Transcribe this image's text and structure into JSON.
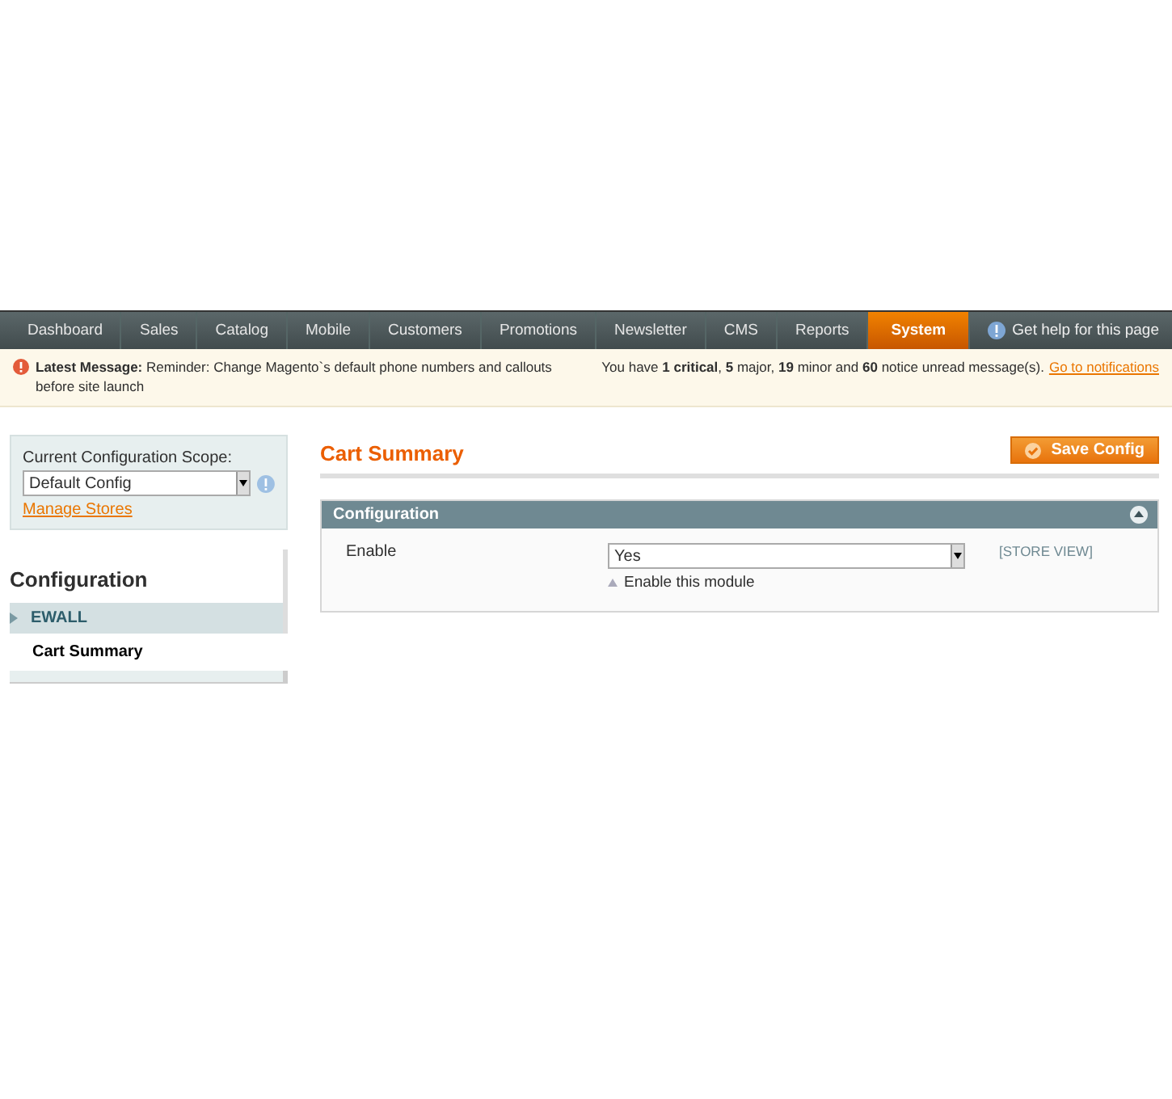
{
  "nav": {
    "items": [
      {
        "label": "Dashboard",
        "selected": false
      },
      {
        "label": "Sales",
        "selected": false
      },
      {
        "label": "Catalog",
        "selected": false
      },
      {
        "label": "Mobile",
        "selected": false
      },
      {
        "label": "Customers",
        "selected": false
      },
      {
        "label": "Promotions",
        "selected": false
      },
      {
        "label": "Newsletter",
        "selected": false
      },
      {
        "label": "CMS",
        "selected": false
      },
      {
        "label": "Reports",
        "selected": false
      },
      {
        "label": "System",
        "selected": true
      }
    ],
    "help": "Get help for this page"
  },
  "message_bar": {
    "latest": "**Latest Message:** Reminder: Change Magento`s default phone numbers and callouts before site launch",
    "summary": "You have **1 critical**, **5** major, **19** minor and **60** notice unread message(s).",
    "link": "Go to notifications"
  },
  "sidebar": {
    "scope_label": "Current Configuration Scope:",
    "scope_value": "Default Config",
    "manage_stores": "Manage Stores",
    "title": "Configuration",
    "groups": [
      {
        "label": "EWALL",
        "children": [
          {
            "label": "Cart Summary",
            "selected": true
          }
        ]
      }
    ]
  },
  "main": {
    "title": "Cart Summary",
    "save_button": "Save Config",
    "section": {
      "title": "Configuration",
      "expanded": true,
      "fields": [
        {
          "label": "Enable",
          "value": "Yes",
          "comment": "Enable this module",
          "scope": "[STORE VIEW]"
        }
      ]
    }
  }
}
